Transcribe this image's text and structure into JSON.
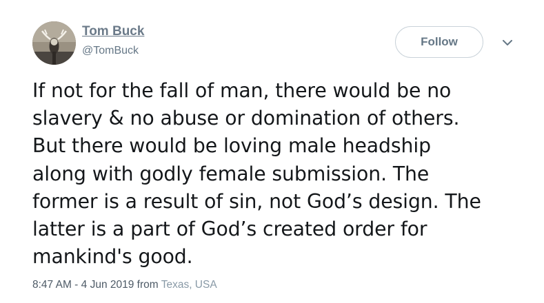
{
  "author": {
    "name": "Tom Buck",
    "handle": "@TomBuck",
    "avatar": "avatar-photo"
  },
  "actions": {
    "follow_label": "Follow",
    "more_icon": "chevron-down-icon"
  },
  "tweet": {
    "lines": [
      "If not for the fall of man, there would be no",
      "slavery & no abuse or domination of others.",
      "But there would be loving male headship",
      "along with godly female submission. The",
      "former is a result of sin, not God’s design. The",
      "latter is a part of God’s created order for",
      "mankind's good."
    ]
  },
  "meta": {
    "timestamp": "8:47 AM - 4 Jun 2019",
    "from_label": "from",
    "location": "Texas, USA"
  }
}
